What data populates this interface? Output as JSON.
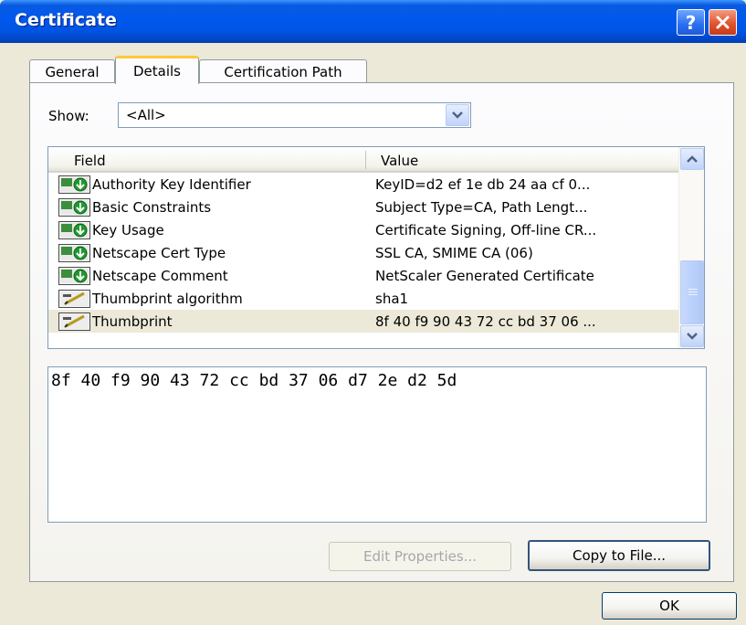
{
  "window": {
    "title": "Certificate"
  },
  "tabs": [
    {
      "label": "General"
    },
    {
      "label": "Details"
    },
    {
      "label": "Certification Path"
    }
  ],
  "show": {
    "label": "Show:",
    "selected": "<All>"
  },
  "list": {
    "columns": {
      "field": "Field",
      "value": "Value"
    },
    "rows": [
      {
        "field": "Authority Key Identifier",
        "value": "KeyID=d2 ef 1e db 24 aa cf 0...",
        "icon": "certificate-extension-icon"
      },
      {
        "field": "Basic Constraints",
        "value": "Subject Type=CA, Path Lengt...",
        "icon": "certificate-extension-icon"
      },
      {
        "field": "Key Usage",
        "value": "Certificate Signing, Off-line CR...",
        "icon": "certificate-extension-icon"
      },
      {
        "field": "Netscape Cert Type",
        "value": "SSL CA, SMIME CA (06)",
        "icon": "certificate-extension-icon"
      },
      {
        "field": "Netscape Comment",
        "value": "NetScaler Generated Certificate",
        "icon": "certificate-extension-icon"
      },
      {
        "field": "Thumbprint algorithm",
        "value": "sha1",
        "icon": "certificate-property-icon"
      },
      {
        "field": "Thumbprint",
        "value": "8f 40 f9 90 43 72 cc bd 37 06 ...",
        "icon": "certificate-property-icon"
      }
    ]
  },
  "value_text": "8f 40 f9 90 43 72 cc bd 37 06 d7 2e d2 5d",
  "buttons": {
    "edit_properties": "Edit Properties...",
    "copy_to_file": "Copy to File...",
    "ok": "OK"
  }
}
